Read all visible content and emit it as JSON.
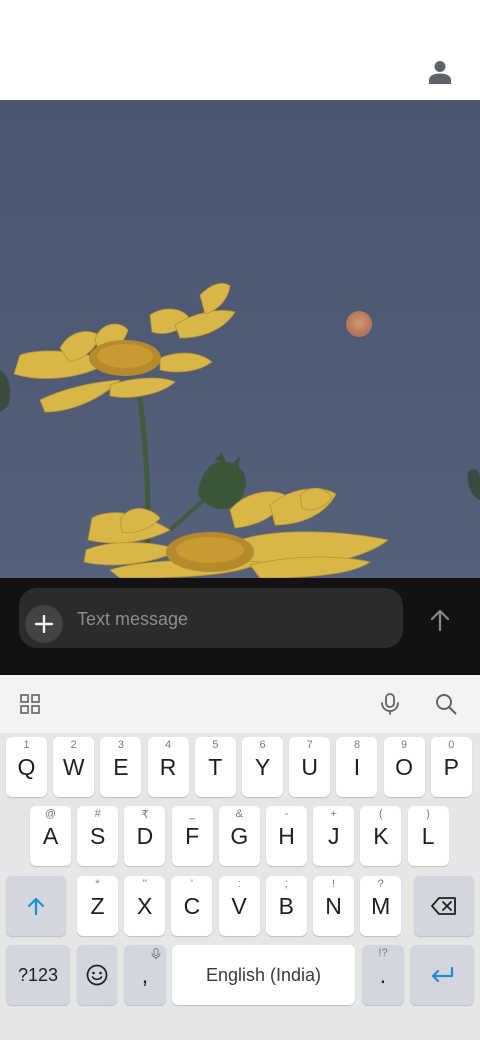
{
  "composer": {
    "placeholder": "Text message",
    "attach_icon": "plus-icon",
    "send_icon": "arrow-up-icon"
  },
  "topbar": {
    "profile_icon": "person-icon"
  },
  "keyboard": {
    "toolbar": [
      "grid-icon",
      "microphone-icon",
      "search-icon"
    ],
    "row1": [
      {
        "key": "Q",
        "hint": "1"
      },
      {
        "key": "W",
        "hint": "2"
      },
      {
        "key": "E",
        "hint": "3"
      },
      {
        "key": "R",
        "hint": "4"
      },
      {
        "key": "T",
        "hint": "5"
      },
      {
        "key": "Y",
        "hint": "6"
      },
      {
        "key": "U",
        "hint": "7"
      },
      {
        "key": "I",
        "hint": "8"
      },
      {
        "key": "O",
        "hint": "9"
      },
      {
        "key": "P",
        "hint": "0"
      }
    ],
    "row2": [
      {
        "key": "A",
        "hint": "@"
      },
      {
        "key": "S",
        "hint": "#"
      },
      {
        "key": "D",
        "hint": "₹"
      },
      {
        "key": "F",
        "hint": "_"
      },
      {
        "key": "G",
        "hint": "&"
      },
      {
        "key": "H",
        "hint": "-"
      },
      {
        "key": "J",
        "hint": "+"
      },
      {
        "key": "K",
        "hint": "("
      },
      {
        "key": "L",
        "hint": ")"
      }
    ],
    "row3": [
      {
        "key": "Z",
        "hint": "*"
      },
      {
        "key": "X",
        "hint": "\""
      },
      {
        "key": "C",
        "hint": "'"
      },
      {
        "key": "V",
        "hint": ":"
      },
      {
        "key": "B",
        "hint": ";"
      },
      {
        "key": "N",
        "hint": "!"
      },
      {
        "key": "M",
        "hint": "?"
      }
    ],
    "symbols_label": "?123",
    "comma_label": ",",
    "space_label": "English (India)",
    "period_label": ".",
    "period_hint": "!?",
    "accent_color": "#1a8fd6"
  }
}
